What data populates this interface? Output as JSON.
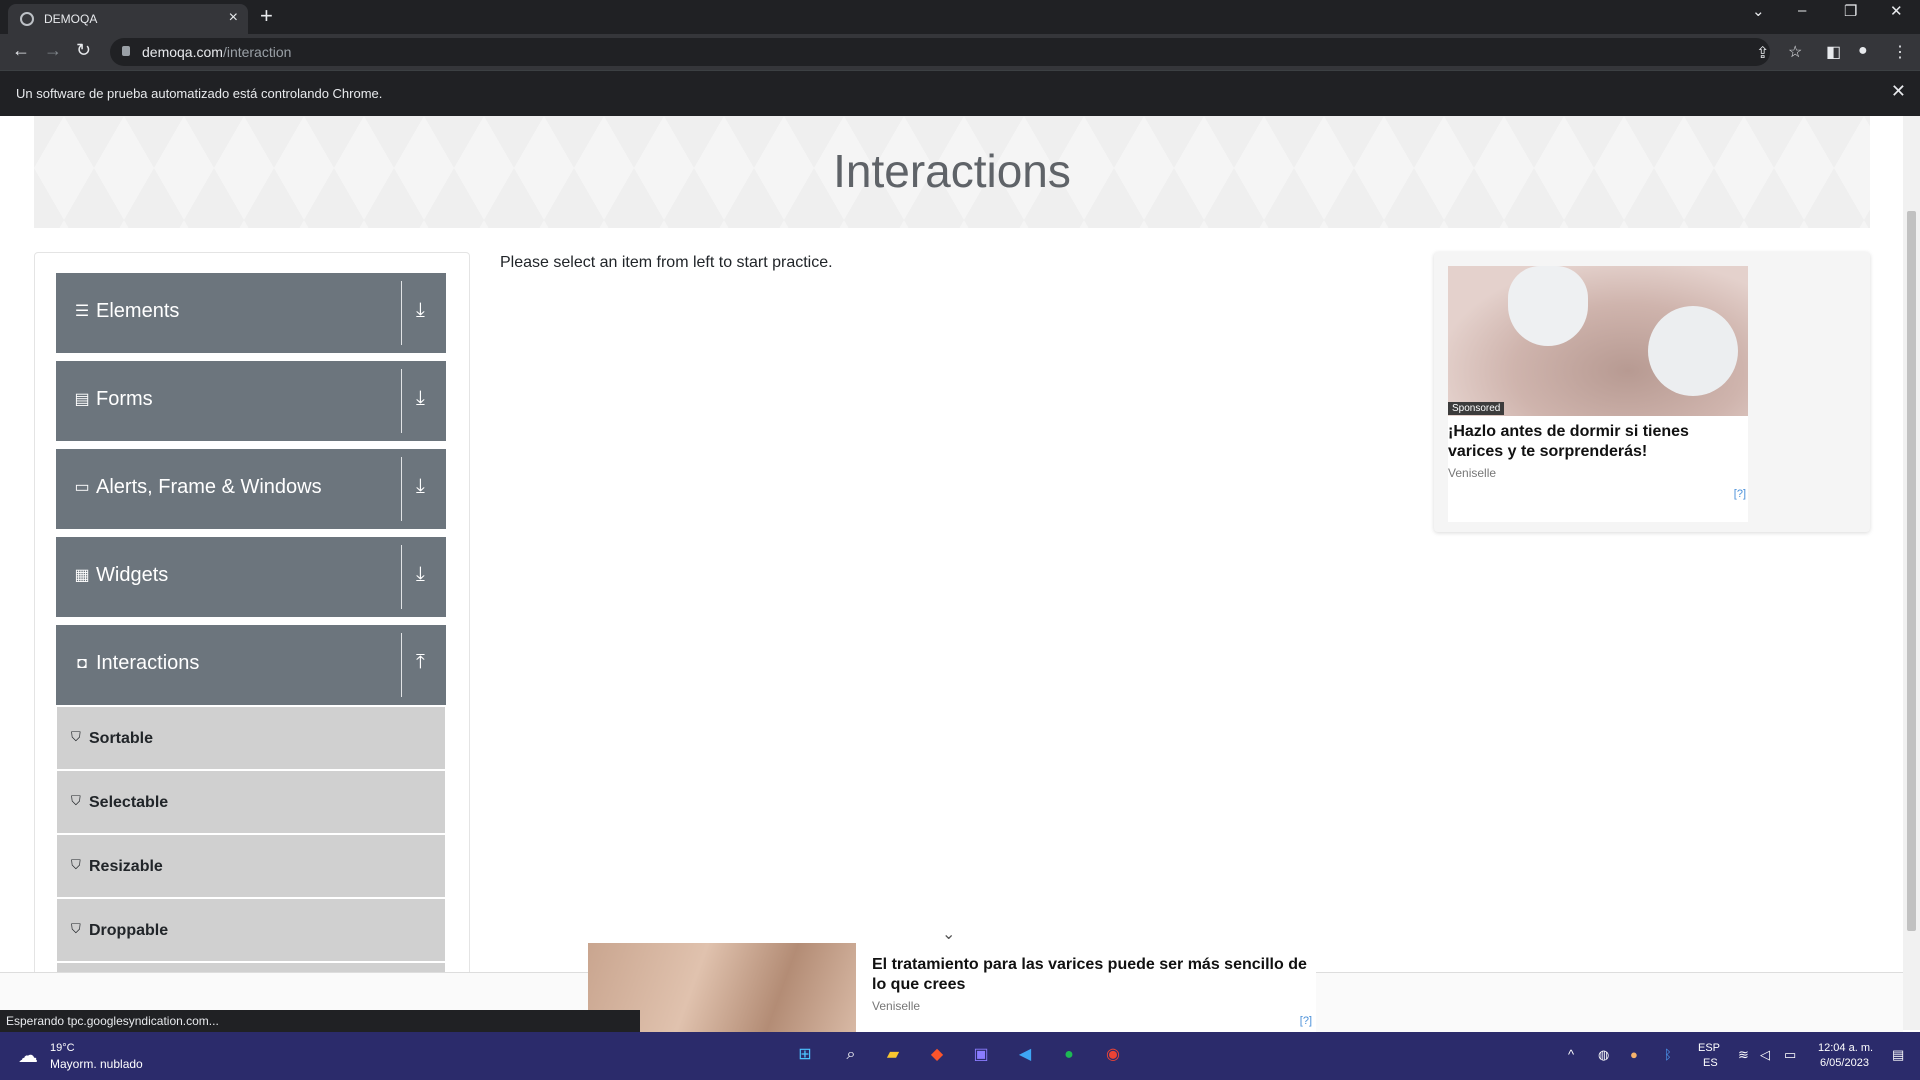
{
  "browser": {
    "tab_title": "DEMOQA",
    "url_domain": "demoqa.com",
    "url_path": "/interaction",
    "infobar_message": "Un software de prueba automatizado está controlando Chrome."
  },
  "page": {
    "banner_title": "Interactions",
    "practice_text": "Please select an item from left to start practice."
  },
  "sidebar": {
    "groups": [
      {
        "label": "Elements",
        "icon": "menu-icon"
      },
      {
        "label": "Forms",
        "icon": "document-icon"
      },
      {
        "label": "Alerts, Frame & Windows",
        "icon": "window-icon"
      },
      {
        "label": "Widgets",
        "icon": "grid-icon"
      },
      {
        "label": "Interactions",
        "icon": "interaction-icon"
      }
    ],
    "items": [
      {
        "label": "Sortable"
      },
      {
        "label": "Selectable"
      },
      {
        "label": "Resizable"
      },
      {
        "label": "Droppable"
      }
    ]
  },
  "side_ad": {
    "badge": "Sponsored",
    "headline": "¡Hazlo antes de dormir si tienes varices y te sorprenderás!",
    "brand": "Veniselle",
    "adchoice": "[?]"
  },
  "bottom_ad": {
    "headline": "El tratamiento para las varices puede ser más sencillo de lo que crees",
    "brand": "Veniselle",
    "adchoice": "[?]"
  },
  "status_bar": "Esperando tpc.googlesyndication.com...",
  "taskbar": {
    "temperature": "19°C",
    "weather": "Mayorm. nublado",
    "lang_top": "ESP",
    "lang_bottom": "ES",
    "time": "12:04 a. m.",
    "date": "6/05/2023"
  },
  "colors": {
    "sidebar_group": "#6c757d",
    "sidebar_item": "#d0d0d0",
    "chrome_dark": "#202124",
    "taskbar": "#2b2b6b"
  }
}
